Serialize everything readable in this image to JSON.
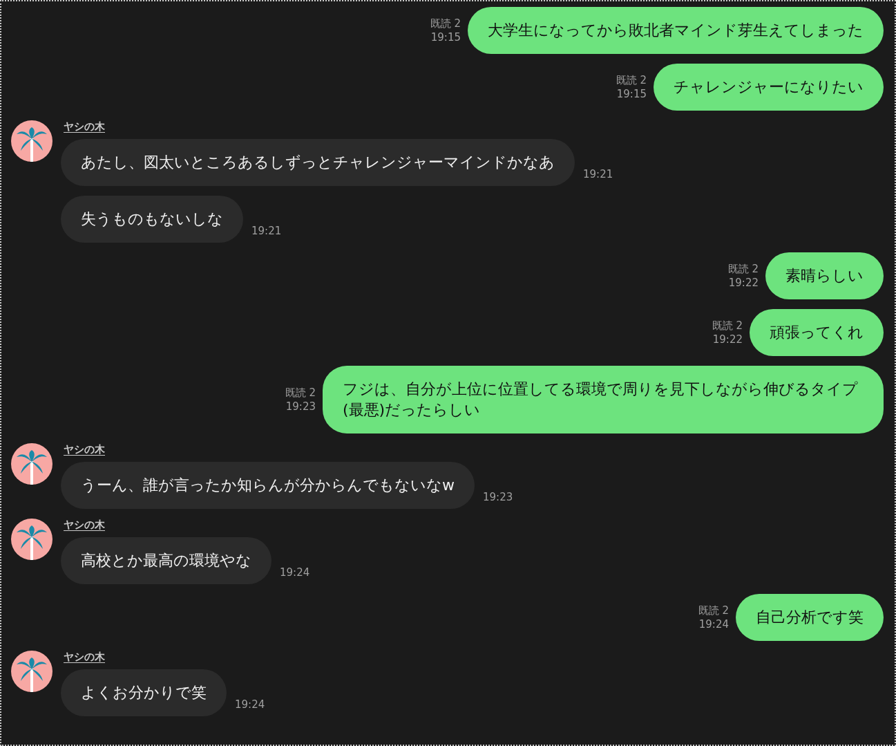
{
  "messages": [
    {
      "kind": "sent",
      "text": "大学生になってから敗北者マインド芽生えてしまった",
      "read": "既読 2",
      "time": "19:15"
    },
    {
      "kind": "sent",
      "text": "チャレンジャーになりたい",
      "read": "既読 2",
      "time": "19:15"
    },
    {
      "kind": "received",
      "sender": "ヤシの木",
      "text": "あたし、図太いところあるしずっとチャレンジャーマインドかなあ",
      "time": "19:21"
    },
    {
      "kind": "received",
      "text": "失うものもないしな",
      "time": "19:21"
    },
    {
      "kind": "sent",
      "text": "素晴らしい",
      "read": "既読 2",
      "time": "19:22"
    },
    {
      "kind": "sent",
      "text": "頑張ってくれ",
      "read": "既読 2",
      "time": "19:22"
    },
    {
      "kind": "sent",
      "text": "フジは、自分が上位に位置してる環境で周りを見下しながら伸びるタイプ(最悪)だったらしい",
      "read": "既読 2",
      "time": "19:23"
    },
    {
      "kind": "received",
      "sender": "ヤシの木",
      "text": "うーん、誰が言ったか知らんが分からんでもないなw",
      "time": "19:23"
    },
    {
      "kind": "received",
      "sender": "ヤシの木",
      "text": "高校とか最高の環境やな",
      "time": "19:24"
    },
    {
      "kind": "sent",
      "text": "自己分析です笑",
      "read": "既読 2",
      "time": "19:24"
    },
    {
      "kind": "received",
      "sender": "ヤシの木",
      "text": "よくお分かりで笑",
      "time": "19:24"
    }
  ]
}
